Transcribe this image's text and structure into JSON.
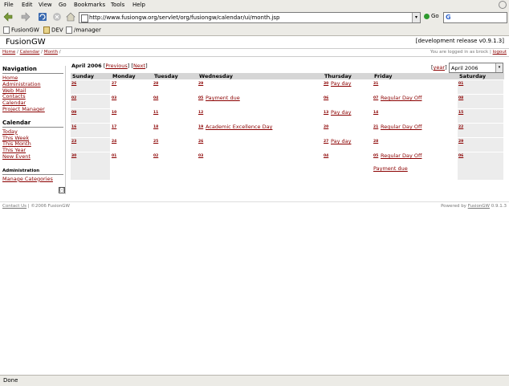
{
  "browser": {
    "menu": [
      "File",
      "Edit",
      "View",
      "Go",
      "Bookmarks",
      "Tools",
      "Help"
    ],
    "url": "http://www.fusiongw.org/servlet/org/fusiongw/calendar/ui/month.jsp",
    "go_label": "Go",
    "search_logo": "G",
    "bookmarks": [
      "FusionGW",
      "DEV",
      "/manager"
    ],
    "status": "Done"
  },
  "app": {
    "title": "FusionGW",
    "release": "[development release v0.9.1.3]",
    "breadcrumb": [
      "Home",
      "Calendar",
      "Month"
    ],
    "login_text": "You are logged in as brock",
    "logout": "logout"
  },
  "sidebar": {
    "nav_heading": "Navigation",
    "nav_items": [
      "Home",
      "Administration",
      "Web Mail",
      "Contacts",
      "Calendar",
      "Project Manager"
    ],
    "cal_heading": "Calendar",
    "cal_items": [
      "Today",
      "This Week",
      "This Month",
      "This Year",
      "New Event"
    ],
    "admin_heading": "Administration",
    "admin_items": [
      "Manage Categories"
    ],
    "collapse": "[-]"
  },
  "calendar": {
    "month_title": "April 2006",
    "previous": "Previous",
    "next": "Next",
    "year_link": "year",
    "month_select": "April 2006",
    "days": [
      "Sunday",
      "Monday",
      "Tuesday",
      "Wednesday",
      "Thursday",
      "Friday",
      "Saturday"
    ],
    "weeks": [
      [
        {
          "d": "26"
        },
        {
          "d": "27"
        },
        {
          "d": "28"
        },
        {
          "d": "29"
        },
        {
          "d": "30",
          "ev": "Pay day"
        },
        {
          "d": "31"
        },
        {
          "d": "01"
        }
      ],
      [
        {
          "d": "02"
        },
        {
          "d": "03"
        },
        {
          "d": "04"
        },
        {
          "d": "05",
          "ev": "Payment due"
        },
        {
          "d": "06"
        },
        {
          "d": "07",
          "ev": "Regular Day Off"
        },
        {
          "d": "08"
        }
      ],
      [
        {
          "d": "09"
        },
        {
          "d": "10"
        },
        {
          "d": "11"
        },
        {
          "d": "12"
        },
        {
          "d": "13",
          "ev": "Pay day"
        },
        {
          "d": "14"
        },
        {
          "d": "15"
        }
      ],
      [
        {
          "d": "16"
        },
        {
          "d": "17"
        },
        {
          "d": "18"
        },
        {
          "d": "19",
          "ev": "Academic Excellence Day"
        },
        {
          "d": "20"
        },
        {
          "d": "21",
          "ev": "Regular Day Off"
        },
        {
          "d": "22"
        }
      ],
      [
        {
          "d": "23"
        },
        {
          "d": "24"
        },
        {
          "d": "25"
        },
        {
          "d": "26"
        },
        {
          "d": "27",
          "ev": "Pay day"
        },
        {
          "d": "28"
        },
        {
          "d": "29"
        }
      ],
      [
        {
          "d": "30"
        },
        {
          "d": "01"
        },
        {
          "d": "02"
        },
        {
          "d": "03"
        },
        {
          "d": "04"
        },
        {
          "d": "05",
          "ev": "Regular Day Off",
          "ev2": "Payment due"
        },
        {
          "d": "06"
        }
      ]
    ]
  },
  "footer": {
    "contact": "Contact Us",
    "copyright": "| ©2006 FusionGW",
    "powered_prefix": "Powered by",
    "powered_link": "FusionGW",
    "powered_version": "0.9.1.3"
  }
}
